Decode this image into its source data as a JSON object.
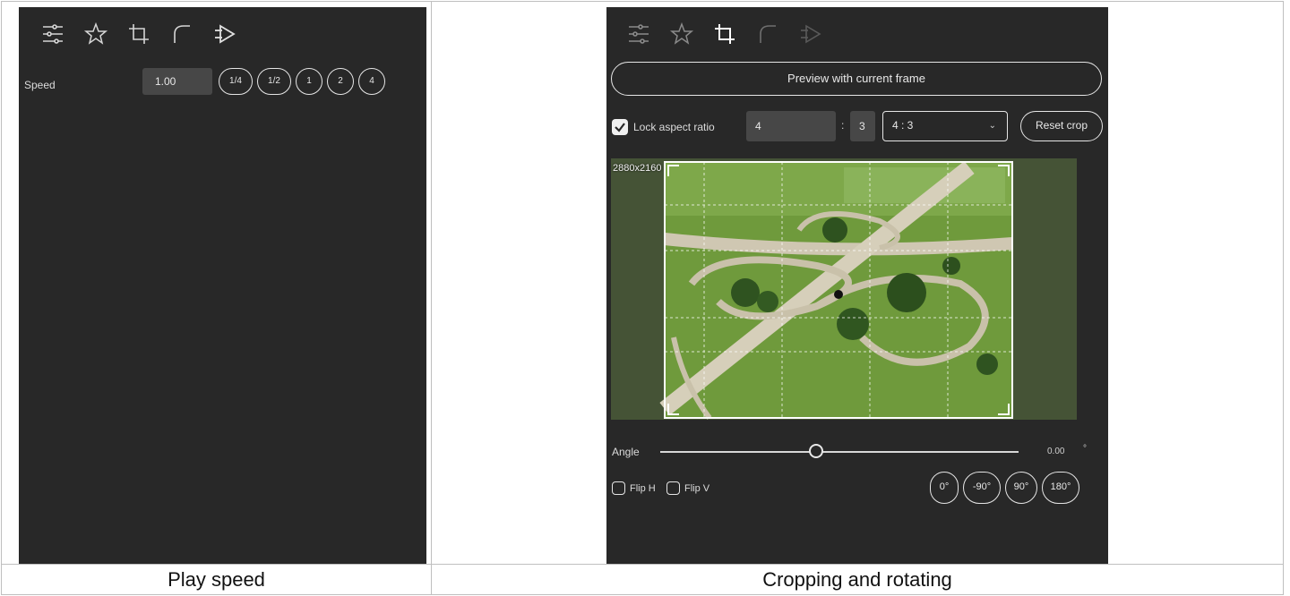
{
  "captions": {
    "left": "Play speed",
    "right": "Cropping and rotating"
  },
  "toolbar": {
    "icons": [
      "sliders-icon",
      "star-icon",
      "crop-icon",
      "curve-icon",
      "play-forward-icon"
    ]
  },
  "speed_panel": {
    "label": "Speed",
    "value": "1.00",
    "presets": [
      "1/4",
      "1/2",
      "1",
      "2",
      "4"
    ]
  },
  "crop_panel": {
    "preview_button": "Preview with current frame",
    "lock_aspect_label": "Lock aspect ratio",
    "lock_aspect_checked": true,
    "ratio_width": "4",
    "ratio_separator": ":",
    "ratio_height": "3",
    "ratio_preset": "4 : 3",
    "reset_button": "Reset crop",
    "image_dims": "2880x2160",
    "angle_label": "Angle",
    "angle_value": "0.00",
    "angle_unit": "°",
    "flip_h_label": "Flip H",
    "flip_v_label": "Flip V",
    "rotate_buttons": [
      "0°",
      "-90°",
      "90°",
      "180°"
    ]
  },
  "colors": {
    "panel_bg": "#282828",
    "field_bg": "#474747",
    "text": "#e6e6e6"
  }
}
